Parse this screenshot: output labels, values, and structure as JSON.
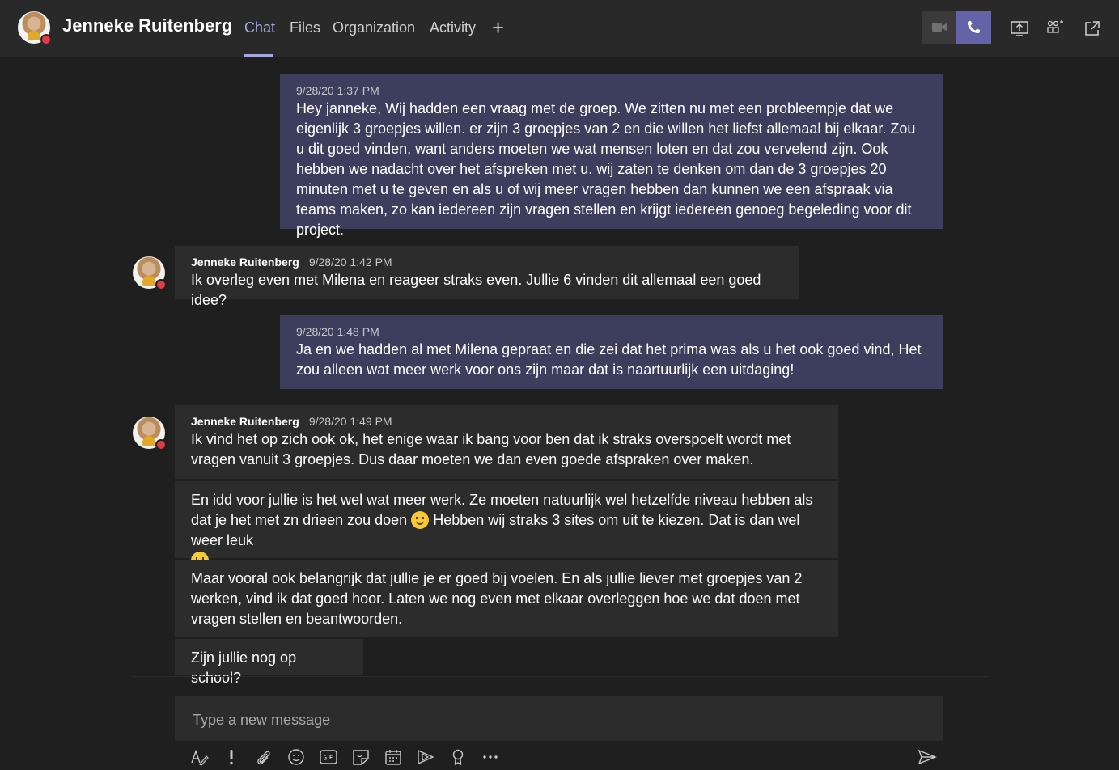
{
  "header": {
    "contact_name": "Jenneke Ruitenberg",
    "tabs": [
      "Chat",
      "Files",
      "Organization",
      "Activity"
    ],
    "active_tab": "Chat",
    "add_tab_symbol": "+"
  },
  "messages": [
    {
      "type": "own",
      "time": "9/28/20 1:37 PM",
      "text": "Hey janneke, Wij hadden een vraag met de groep. We zitten nu met een probleempje dat we eigenlijk 3 groepjes willen. er zijn 3 groepjes van 2 en die willen het liefst allemaal bij elkaar. Zou u dit goed vinden, want anders moeten we wat mensen loten en dat zou vervelend zijn. Ook hebben we nadacht over het afspreken met u. wij zaten te denken om dan de 3 groepjes 20 minuten met u te geven en als u of wij meer vragen hebben dan kunnen we een afspraak via teams maken, zo kan iedereen zijn vragen stellen en krijgt iedereen genoeg begeleding voor dit project."
    },
    {
      "type": "other",
      "sender": "Jenneke Ruitenberg",
      "time": "9/28/20 1:42 PM",
      "text": "Ik overleg even met Milena en reageer straks even. Jullie 6  vinden dit allemaal een goed idee?"
    },
    {
      "type": "own",
      "time": "9/28/20 1:48 PM",
      "text": "Ja en we hadden al met Milena gepraat en die zei dat het prima was als u het ook goed vind, Het zou alleen wat meer werk voor ons zijn maar dat is naartuurlijk een uitdaging!"
    },
    {
      "type": "other",
      "sender": "Jenneke Ruitenberg",
      "time": "9/28/20 1:49 PM",
      "text": "Ik vind het op zich ook ok, het enige waar ik bang voor ben dat ik straks overspoelt wordt met vragen vanuit 3 groepjes. Dus daar moeten we dan even goede afspraken over maken."
    },
    {
      "type": "other-cont",
      "text_a": "En idd voor jullie is het wel wat meer werk. Ze moeten natuurlijk wel hetzelfde niveau hebben als dat je het met zn drieen zou doen",
      "text_b": "Hebben wij straks 3 sites om uit te kiezen. Dat is dan wel weer leuk"
    },
    {
      "type": "other-cont",
      "text": "Maar vooral ook belangrijk dat jullie je er goed bij voelen. En als jullie liever met groepjes van 2 werken, vind ik dat goed hoor. Laten we nog even met elkaar overleggen hoe we dat doen met vragen stellen en beantwoorden."
    },
    {
      "type": "other-cont",
      "text": "Zijn jullie nog op school?"
    }
  ],
  "compose": {
    "placeholder": "Type a new message"
  },
  "icons": {
    "header_buttons": [
      "video-call-icon",
      "audio-call-icon",
      "share-screen-icon",
      "add-people-icon",
      "pop-out-icon"
    ],
    "toolbar": [
      "format-icon",
      "important-icon",
      "attach-icon",
      "emoji-icon",
      "gif-icon",
      "sticker-icon",
      "schedule-meeting-icon",
      "stream-icon",
      "praise-icon",
      "more-options-icon",
      "send-icon"
    ]
  },
  "colors": {
    "accent": "#6264a7",
    "active_tab": "#a6a7dc",
    "own_bubble": "#3d3e5e",
    "other_bubble": "#2d2c2c",
    "status_busy": "#e23b47"
  }
}
